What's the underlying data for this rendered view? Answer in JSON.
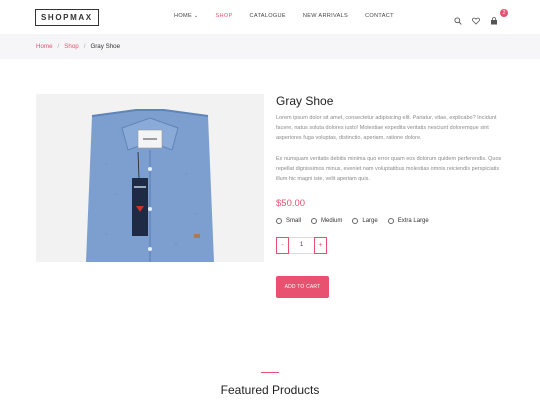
{
  "header": {
    "logo": "SHOPMAX",
    "nav": [
      {
        "label": "HOME",
        "dropdown": true
      },
      {
        "label": "SHOP"
      },
      {
        "label": "CATALOGUE"
      },
      {
        "label": "NEW ARRIVALS"
      },
      {
        "label": "CONTACT"
      }
    ],
    "active_nav": "SHOP",
    "icons": [
      "search-icon",
      "heart-icon",
      "cart-icon"
    ],
    "cart_count": "2"
  },
  "breadcrumb": {
    "home": "Home",
    "shop": "Shop",
    "separator": "/",
    "current": "Gray Shoe"
  },
  "product": {
    "title": "Gray Shoe",
    "description_1": "Lorem ipsum dolor sit amet, consectetur adipisicing elit. Pariatur, vitae, explicabo? Incidunt facere, natus soluta dolores iusto! Molestiae expedita veritatis nesciunt doloremque sint asperiores fuga voluptas, distinctio, aperiam, ratione dolore.",
    "description_2": "Ex numquam veritatis debitis minima quo error quam eos dolorum quidem perferendis. Quos repellat dignissimos minus, eveniet nam voluptatibus molestias omnis reiciendis perspiciatis illum hic magni iste, velit aperiam quis.",
    "price": "$50.00",
    "sizes": [
      "Small",
      "Medium",
      "Large",
      "Extra Large"
    ],
    "quantity": "1",
    "minus": "-",
    "plus": "+",
    "add_to_cart": "ADD TO CART"
  },
  "featured_title": "Featured Products",
  "colors": {
    "accent": "#e8516f",
    "shirt": "#7d9fd0"
  }
}
